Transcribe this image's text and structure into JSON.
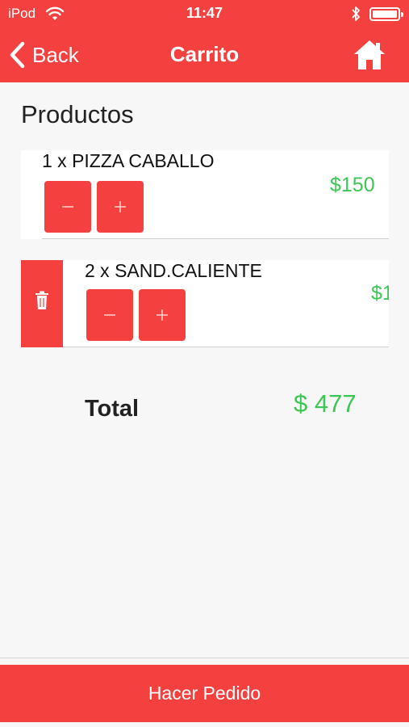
{
  "status_bar": {
    "carrier": "iPod",
    "time": "11:47",
    "icons": [
      "wifi-icon",
      "bluetooth-icon",
      "battery-icon"
    ]
  },
  "nav": {
    "back_label": "Back",
    "title": "Carrito",
    "home_icon": "home-icon"
  },
  "section_title": "Productos",
  "items": [
    {
      "name": "1 x PIZZA CABALLO",
      "price": "$150"
    },
    {
      "name": "2 x SAND.CALIENTE",
      "price": "$1"
    }
  ],
  "controls": {
    "minus_icon": "minus-icon",
    "plus_icon": "plus-icon",
    "delete_icon": "trash-icon"
  },
  "total": {
    "label": "Total",
    "value": "$ 477"
  },
  "order_button": "Hacer Pedido",
  "colors": {
    "accent": "#f4403f",
    "price": "#3dc653",
    "background": "#f7f7f7"
  }
}
